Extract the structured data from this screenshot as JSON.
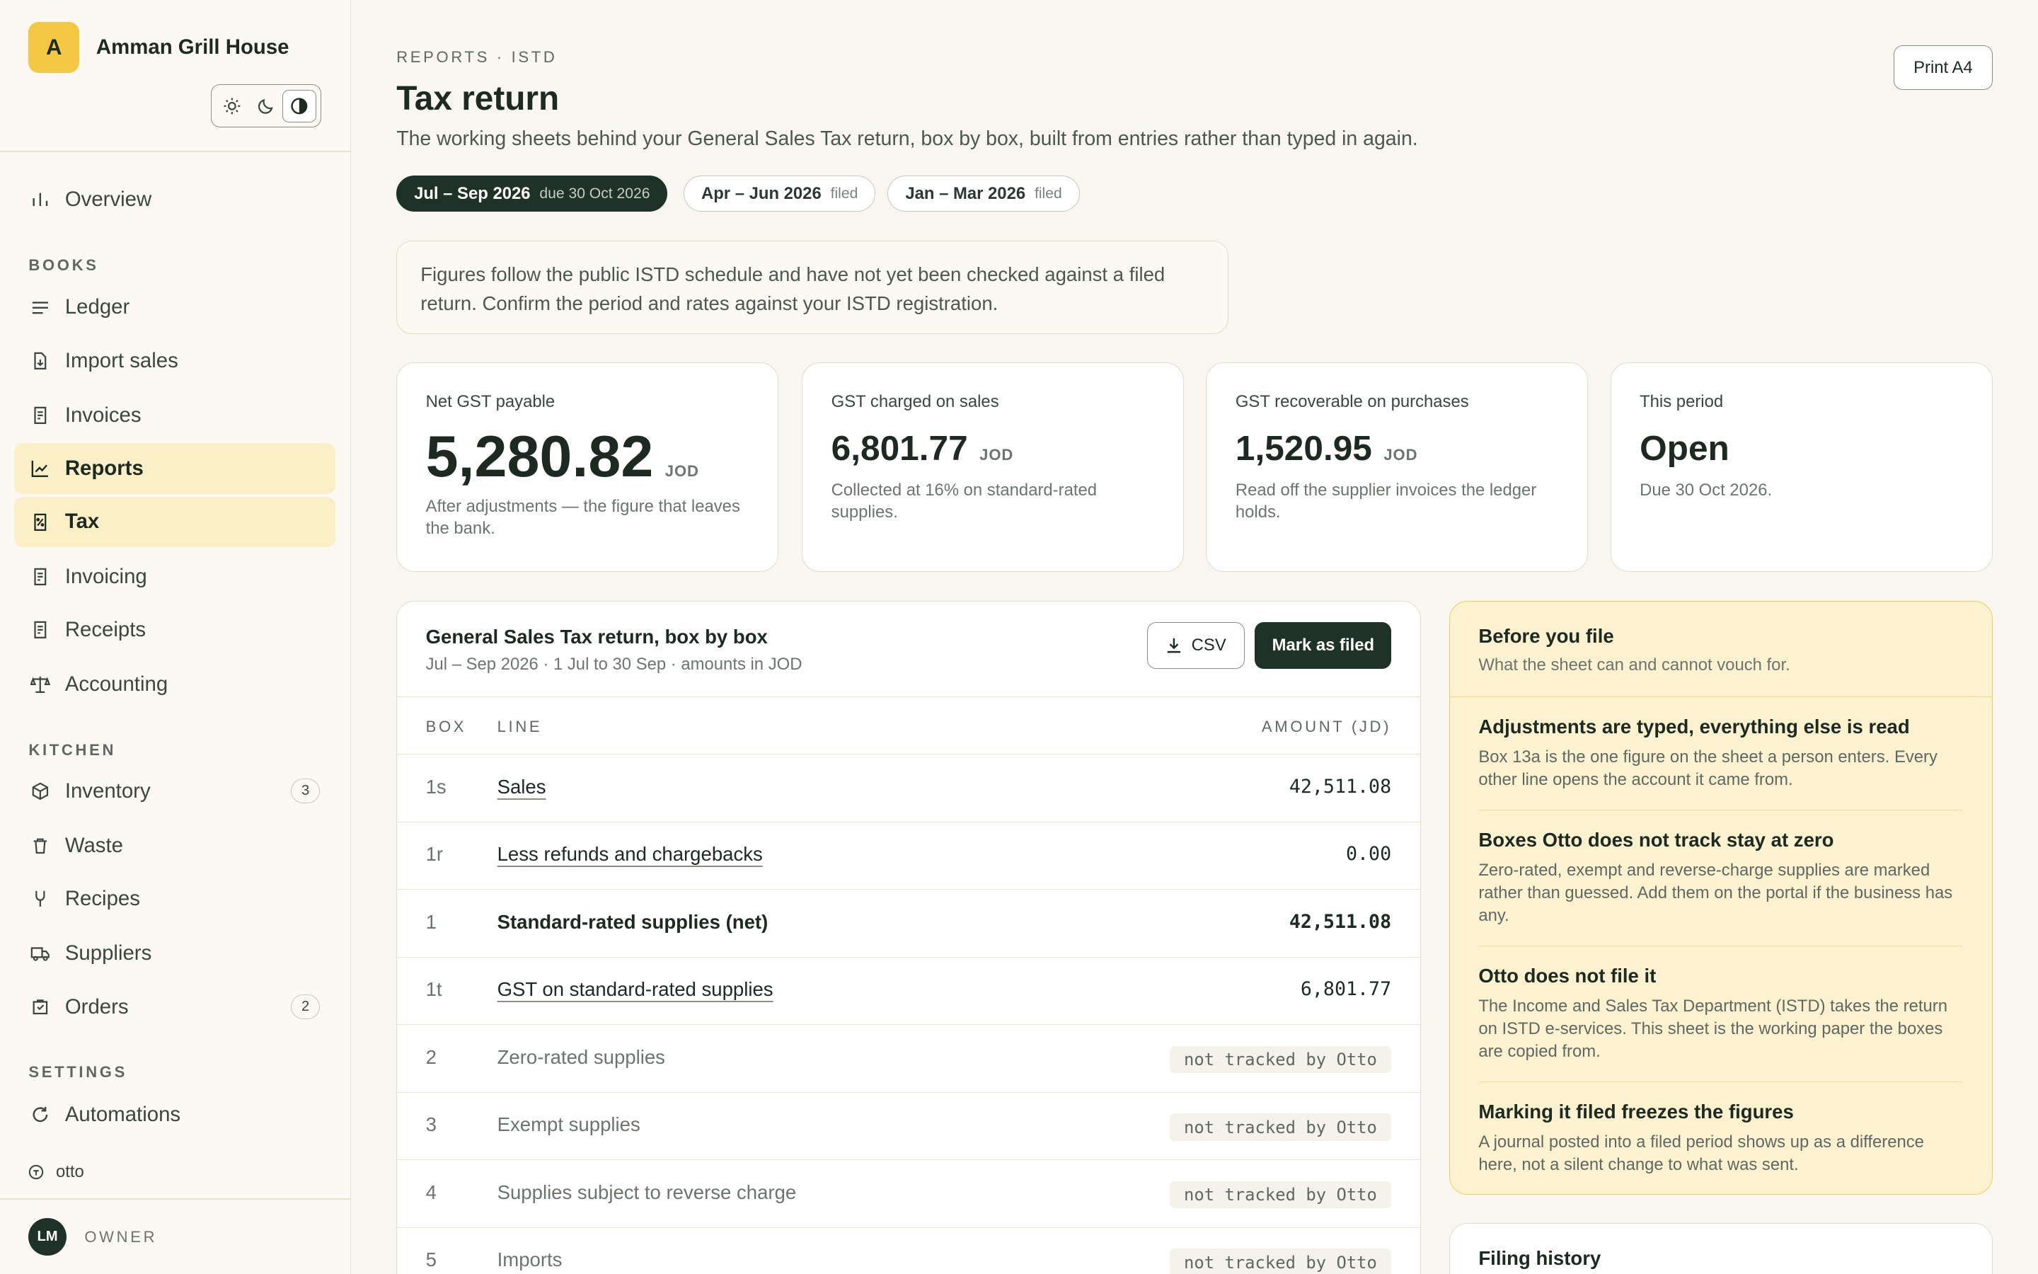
{
  "brand": {
    "initial": "A",
    "name": "Amman Grill House"
  },
  "theme": {
    "light_icon": "sun-icon",
    "dark_icon": "moon-icon",
    "auto_icon": "contrast-icon",
    "selected": "auto"
  },
  "nav": {
    "overview": {
      "label": "Overview",
      "icon": "bar-chart-icon"
    },
    "sections": {
      "books": "BOOKS",
      "kitchen": "KITCHEN",
      "settings": "SETTINGS"
    },
    "books": [
      {
        "label": "Ledger",
        "icon": "lines-icon"
      },
      {
        "label": "Import sales",
        "icon": "file-import-icon"
      },
      {
        "label": "Invoices",
        "icon": "receipt-icon"
      },
      {
        "label": "Reports",
        "icon": "trend-icon"
      },
      {
        "label": "Tax",
        "icon": "tax-icon"
      },
      {
        "label": "Invoicing",
        "icon": "receipt-icon"
      },
      {
        "label": "Receipts",
        "icon": "receipt-icon"
      },
      {
        "label": "Accounting",
        "icon": "scale-icon"
      }
    ],
    "kitchen": [
      {
        "label": "Inventory",
        "icon": "box-icon",
        "badge": "3"
      },
      {
        "label": "Waste",
        "icon": "trash-icon"
      },
      {
        "label": "Recipes",
        "icon": "fork-icon"
      },
      {
        "label": "Suppliers",
        "icon": "truck-icon"
      },
      {
        "label": "Orders",
        "icon": "cart-icon",
        "badge": "2"
      }
    ],
    "settings": [
      {
        "label": "Automations",
        "icon": "refresh-icon"
      }
    ]
  },
  "footer": {
    "otto_label": "otto",
    "user_initials": "LM",
    "role": "OWNER"
  },
  "header": {
    "breadcrumb": "REPORTS · ISTD",
    "title": "Tax return",
    "subtitle": "The working sheets behind your General Sales Tax return, box by box, built from entries rather than typed in again.",
    "print_label": "Print A4"
  },
  "periods": [
    {
      "label": "Jul – Sep 2026",
      "tag": "due 30 Oct 2026",
      "active": true
    },
    {
      "label": "Apr – Jun 2026",
      "tag": "filed",
      "active": false
    },
    {
      "label": "Jan – Mar 2026",
      "tag": "filed",
      "active": false
    }
  ],
  "notice": "Figures follow the public ISTD schedule and have not yet been checked against a filed return. Confirm the period and rates against your ISTD registration.",
  "kpis": [
    {
      "label": "Net GST payable",
      "value": "5,280.82",
      "unit": "JOD",
      "note": "After adjustments — the figure that leaves the bank."
    },
    {
      "label": "GST charged on sales",
      "value": "6,801.77",
      "unit": "JOD",
      "note": "Collected at 16% on standard-rated supplies."
    },
    {
      "label": "GST recoverable on purchases",
      "value": "1,520.95",
      "unit": "JOD",
      "note": "Read off the supplier invoices the ledger holds."
    },
    {
      "label": "This period",
      "value": "Open",
      "unit": "",
      "note": "Due 30 Oct 2026."
    }
  ],
  "return_table": {
    "title": "General Sales Tax return, box by box",
    "subtitle": "Jul – Sep 2026 · 1 Jul to 30 Sep · amounts in JOD",
    "csv_label": "CSV",
    "mark_filed_label": "Mark as filed",
    "headers": {
      "box": "BOX",
      "line": "LINE",
      "amount": "AMOUNT (JD)"
    },
    "rows": [
      {
        "box": "1s",
        "line": "Sales",
        "amount": "42,511.08"
      },
      {
        "box": "1r",
        "line": "Less refunds and chargebacks",
        "amount": "0.00"
      },
      {
        "box": "1",
        "line": "Standard-rated supplies (net)",
        "amount": "42,511.08"
      },
      {
        "box": "1t",
        "line": "GST on standard-rated supplies",
        "amount": "6,801.77"
      },
      {
        "box": "2",
        "line": "Zero-rated supplies",
        "amount": "not tracked by Otto"
      },
      {
        "box": "3",
        "line": "Exempt supplies",
        "amount": "not tracked by Otto"
      },
      {
        "box": "4",
        "line": "Supplies subject to reverse charge",
        "amount": "not tracked by Otto"
      },
      {
        "box": "5",
        "line": "Imports",
        "amount": "not tracked by Otto"
      }
    ]
  },
  "before_you_file": {
    "title": "Before you file",
    "subtitle": "What the sheet can and cannot vouch for.",
    "items": [
      {
        "title": "Adjustments are typed, everything else is read",
        "body": "Box 13a is the one figure on the sheet a person enters. Every other line opens the account it came from."
      },
      {
        "title": "Boxes Otto does not track stay at zero",
        "body": "Zero-rated, exempt and reverse-charge supplies are marked rather than guessed. Add them on the portal if the business has any."
      },
      {
        "title": "Otto does not file it",
        "body": "The Income and Sales Tax Department (ISTD) takes the return on ISTD e-services. This sheet is the working paper the boxes are copied from."
      },
      {
        "title": "Marking it filed freezes the figures",
        "body": "A journal posted into a filed period shows up as a difference here, not a silent change to what was sent."
      }
    ]
  },
  "filing_history": {
    "title": "Filing history"
  }
}
